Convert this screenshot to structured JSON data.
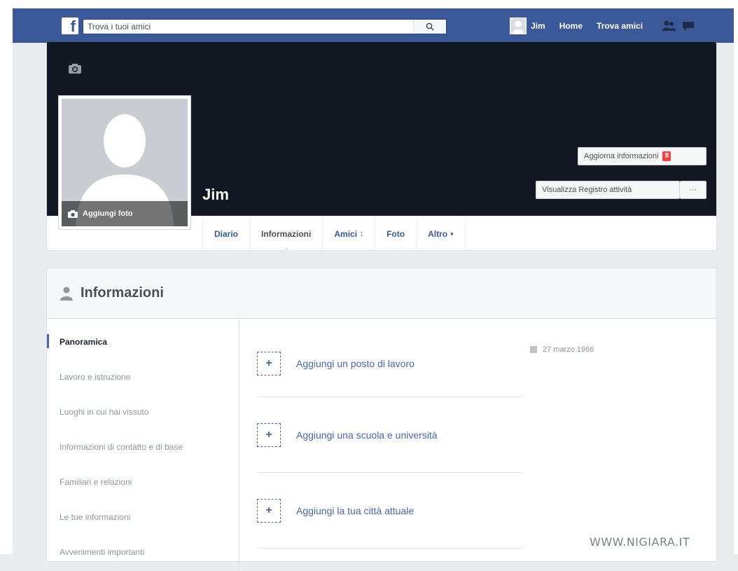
{
  "topbar": {
    "search_placeholder": "Trova i tuoi amici",
    "user_name": "Jim",
    "home_label": "Home",
    "find_friends_label": "Trova amici"
  },
  "cover": {
    "profile_name": "Jim",
    "add_photo_label": "Aggiungi foto",
    "update_info_label": "Aggiorna informazioni",
    "update_info_badge": "8",
    "activity_log_label": "Visualizza Registro attività",
    "more_label": "···"
  },
  "tabs": [
    {
      "label": "Diario"
    },
    {
      "label": "Informazioni"
    },
    {
      "label": "Amici"
    },
    {
      "label": "Foto"
    },
    {
      "label": "Altro"
    }
  ],
  "tabs_extra": {
    "friends_count": "1",
    "more_caret": "▾"
  },
  "info": {
    "title": "Informazioni",
    "side_items": [
      {
        "label": "Panoramica"
      },
      {
        "label": "Lavoro e istruzione"
      },
      {
        "label": "Luoghi in cui hai vissuto"
      },
      {
        "label": "Informazioni di contatto e di base"
      },
      {
        "label": "Familiari e relazioni"
      },
      {
        "label": "Le tue informazioni"
      },
      {
        "label": "Avvenimenti importanti"
      }
    ],
    "add_items": [
      {
        "label": "Aggiungi un posto di lavoro"
      },
      {
        "label": "Aggiungi una scuola e università"
      },
      {
        "label": "Aggiungi la tua città attuale"
      }
    ],
    "plus_symbol": "+",
    "birthdate": "27 marzo 1966"
  },
  "watermark": "WWW.NIGIARA.IT",
  "colors": {
    "topbar": "#3b5998",
    "link": "#4267b2",
    "cover": "#141823",
    "badge": "#fa3e3e"
  }
}
